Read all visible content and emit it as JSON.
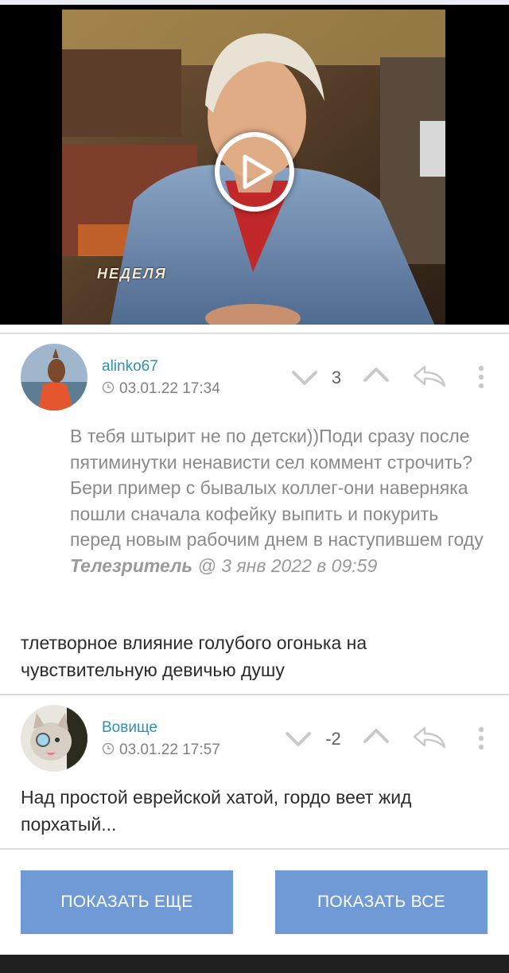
{
  "video": {
    "channel_logo_text": "НЕДЕЛЯ"
  },
  "comments": [
    {
      "author": "alinko67",
      "timestamp": "03.01.22 17:34",
      "score": "3",
      "quote": {
        "text": "В тебя штырит не по детски))Поди сразу после пятиминутки ненависти сел коммент строчить? Бери пример с бывалых коллег-они наверняка пошли сначала кофейку выпить и покурить перед новым рабочим днем в наступившем году",
        "author": "Телезритель",
        "at": "@",
        "date": "3 янв 2022 в 09:59"
      },
      "text": "тлетворное влияние голубого огонька на чувствительную девичью душу"
    },
    {
      "author": "Вовище",
      "timestamp": "03.01.22 17:57",
      "score": "-2",
      "text": "Над простой еврейской хатой, гордо веет жид порхатый..."
    }
  ],
  "buttons": {
    "show_more": "ПОКАЗАТЬ ЕЩЕ",
    "show_all": "ПОКАЗАТЬ ВСЕ"
  },
  "colors": {
    "author": "#2f8fb5",
    "button": "#6f9ad6",
    "icon": "#c9c9c9"
  }
}
